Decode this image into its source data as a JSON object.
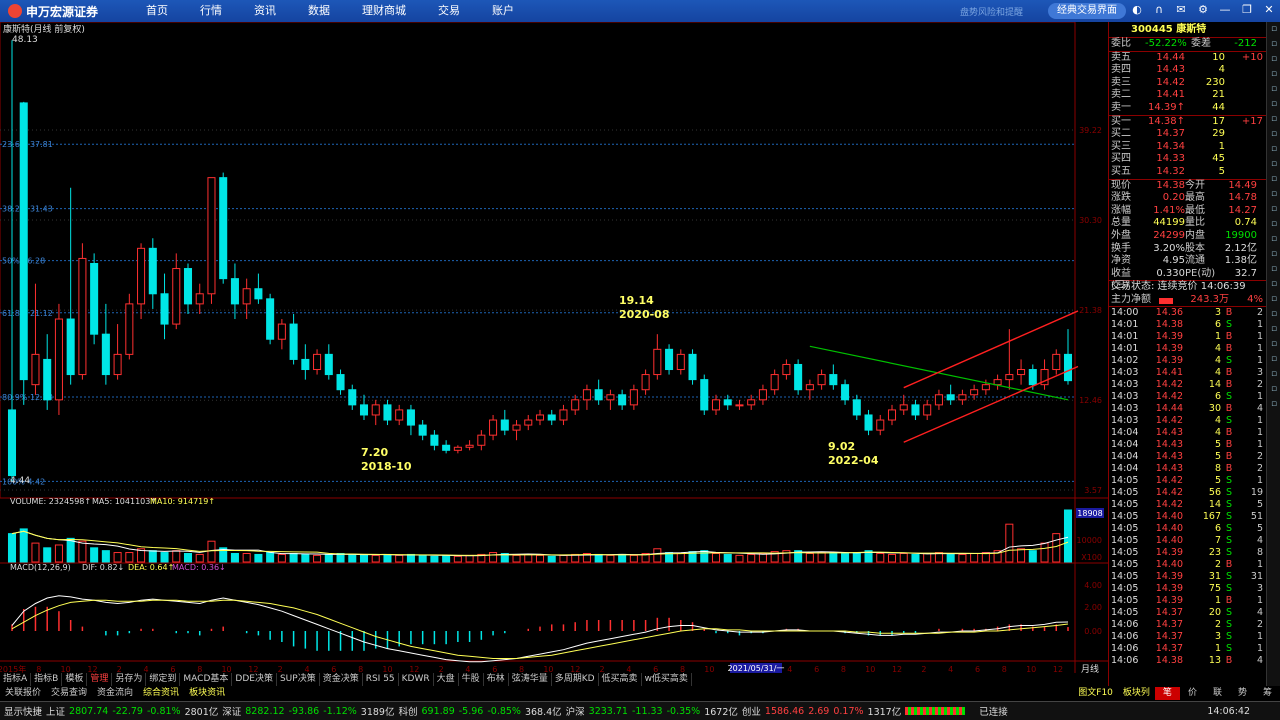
{
  "topbar": {
    "brand": "申万宏源证券",
    "nav": [
      "首页",
      "行情",
      "资讯",
      "数据",
      "理财商城",
      "交易",
      "账户"
    ],
    "hint": "盘势风险和提醒",
    "classic_button": "经典交易界面",
    "icons": [
      "theme-icon",
      "headset-icon",
      "mail-icon",
      "settings-icon",
      "minimize-icon",
      "restore-icon",
      "close-icon"
    ]
  },
  "chart": {
    "title": "康斯特(月线 前复权)",
    "price_max": "48.13",
    "price_min": "4.44",
    "fib_labels": [
      {
        "pct": "23.6%",
        "value": "37.81"
      },
      {
        "pct": "38.2%",
        "value": "31.43"
      },
      {
        "pct": "50%",
        "value": "26.28"
      },
      {
        "pct": "61.8%",
        "value": "21.12"
      },
      {
        "pct": "80.9%",
        "value": "12.78"
      },
      {
        "pct": "100%",
        "value": "4.42"
      }
    ],
    "right_axis": [
      "39.22",
      "30.30",
      "21.38",
      "12.46",
      "3.57"
    ],
    "annotations": [
      {
        "text": "19.14",
        "sub": "2020-08"
      },
      {
        "text": "7.20",
        "sub": "2018-10"
      },
      {
        "text": "9.02",
        "sub": "2022-04"
      }
    ],
    "volume_label": "VOLUME: 2324598↑",
    "ma5_label": "MA5: 1041103↑",
    "ma10_label": "MA10: 914719↑",
    "volume_axis": [
      "10000",
      "X100"
    ],
    "volume_tag": "18908",
    "macd_label": "MACD(12,26,9)",
    "dif_label": "DIF: 0.82↓",
    "dea_label": "DEA: 0.64↑",
    "macd_val": "MACD: 0.36↓",
    "macd_axis": [
      "4.00",
      "2.00",
      "0.00"
    ],
    "x_axis": [
      "2015年",
      "8",
      "10",
      "12",
      "2",
      "4",
      "6",
      "8",
      "10",
      "12",
      "2",
      "4",
      "6",
      "8",
      "10",
      "12",
      "2",
      "4",
      "6",
      "8",
      "10",
      "12",
      "2",
      "4",
      "6",
      "8",
      "10",
      "12",
      "2",
      "4",
      "6",
      "8",
      "10",
      "12",
      "2",
      "4",
      "6",
      "8",
      "10",
      "12"
    ],
    "cursor_date": "2021/05/31/一",
    "period": "月线",
    "colors": {
      "up": "#ff3030",
      "down": "#00e6e6",
      "ma5": "#ffffff",
      "ma10": "#ffff55",
      "trend": "#00c000",
      "channel": "#ff2020"
    }
  },
  "chart_data": {
    "type": "candlestick",
    "title": "康斯特(月线 前复权)",
    "ylim": [
      3.57,
      48.13
    ],
    "candles": [
      [
        11.5,
        48.1,
        4.4,
        5.0
      ],
      [
        41.9,
        42.0,
        12.0,
        14.5
      ],
      [
        14.0,
        24.0,
        13.0,
        17.0
      ],
      [
        16.5,
        19.0,
        11.5,
        12.5
      ],
      [
        12.5,
        22.0,
        11.0,
        20.5
      ],
      [
        20.5,
        33.5,
        14.0,
        15.0
      ],
      [
        15.0,
        28.0,
        14.5,
        26.5
      ],
      [
        26.0,
        27.0,
        18.0,
        19.0
      ],
      [
        19.0,
        22.0,
        14.0,
        15.0
      ],
      [
        15.0,
        20.0,
        14.5,
        17.0
      ],
      [
        17.0,
        23.0,
        16.5,
        22.0
      ],
      [
        22.0,
        28.0,
        20.5,
        27.5
      ],
      [
        27.5,
        28.5,
        21.5,
        23.0
      ],
      [
        23.0,
        25.0,
        18.5,
        20.0
      ],
      [
        20.0,
        27.0,
        19.5,
        25.5
      ],
      [
        25.5,
        26.0,
        21.0,
        22.0
      ],
      [
        22.0,
        24.0,
        21.0,
        23.0
      ],
      [
        23.0,
        34.5,
        22.0,
        34.5
      ],
      [
        34.5,
        35.0,
        24.0,
        24.5
      ],
      [
        24.5,
        26.0,
        20.5,
        22.0
      ],
      [
        22.0,
        24.5,
        20.5,
        23.5
      ],
      [
        23.5,
        25.0,
        22.0,
        22.5
      ],
      [
        22.5,
        23.0,
        18.0,
        18.5
      ],
      [
        18.5,
        20.5,
        17.5,
        20.0
      ],
      [
        20.0,
        21.0,
        16.0,
        16.5
      ],
      [
        16.5,
        18.0,
        14.5,
        15.5
      ],
      [
        15.5,
        17.5,
        15.0,
        17.0
      ],
      [
        17.0,
        18.0,
        14.5,
        15.0
      ],
      [
        15.0,
        15.5,
        13.0,
        13.5
      ],
      [
        13.5,
        14.0,
        11.5,
        12.0
      ],
      [
        12.0,
        13.0,
        10.5,
        11.0
      ],
      [
        11.0,
        12.5,
        10.0,
        12.0
      ],
      [
        12.0,
        12.5,
        10.0,
        10.5
      ],
      [
        10.5,
        12.0,
        10.0,
        11.5
      ],
      [
        11.5,
        12.0,
        9.0,
        10.0
      ],
      [
        10.0,
        10.5,
        8.5,
        9.0
      ],
      [
        9.0,
        9.5,
        7.5,
        8.0
      ],
      [
        8.0,
        8.5,
        7.2,
        7.5
      ],
      [
        7.5,
        8.0,
        7.2,
        7.8
      ],
      [
        7.8,
        8.5,
        7.5,
        8.0
      ],
      [
        8.0,
        9.5,
        7.5,
        9.0
      ],
      [
        9.0,
        11.0,
        8.5,
        10.5
      ],
      [
        10.5,
        11.5,
        9.0,
        9.5
      ],
      [
        9.5,
        10.5,
        8.5,
        10.0
      ],
      [
        10.0,
        11.0,
        9.5,
        10.5
      ],
      [
        10.5,
        11.5,
        10.0,
        11.0
      ],
      [
        11.0,
        11.5,
        10.0,
        10.5
      ],
      [
        10.5,
        12.0,
        10.0,
        11.5
      ],
      [
        11.5,
        13.0,
        11.0,
        12.5
      ],
      [
        12.5,
        14.0,
        11.5,
        13.5
      ],
      [
        13.5,
        14.5,
        12.0,
        12.5
      ],
      [
        12.5,
        13.5,
        11.5,
        13.0
      ],
      [
        13.0,
        13.5,
        11.5,
        12.0
      ],
      [
        12.0,
        14.0,
        11.5,
        13.5
      ],
      [
        13.5,
        15.5,
        13.0,
        15.0
      ],
      [
        15.0,
        19.0,
        14.5,
        17.5
      ],
      [
        17.5,
        18.0,
        15.0,
        15.5
      ],
      [
        15.5,
        17.5,
        15.0,
        17.0
      ],
      [
        17.0,
        17.5,
        14.0,
        14.5
      ],
      [
        14.5,
        15.0,
        11.0,
        11.5
      ],
      [
        11.5,
        13.0,
        11.0,
        12.5
      ],
      [
        12.5,
        13.0,
        11.5,
        12.0
      ],
      [
        12.0,
        12.5,
        11.5,
        12.0
      ],
      [
        12.0,
        13.0,
        11.5,
        12.5
      ],
      [
        12.5,
        14.0,
        12.0,
        13.5
      ],
      [
        13.5,
        15.5,
        13.0,
        15.0
      ],
      [
        15.0,
        16.5,
        14.5,
        16.0
      ],
      [
        16.0,
        16.5,
        13.0,
        13.5
      ],
      [
        13.5,
        14.5,
        12.5,
        14.0
      ],
      [
        14.0,
        15.5,
        13.5,
        15.0
      ],
      [
        15.0,
        16.0,
        13.5,
        14.0
      ],
      [
        14.0,
        14.5,
        12.0,
        12.5
      ],
      [
        12.5,
        13.0,
        10.5,
        11.0
      ],
      [
        11.0,
        11.5,
        9.0,
        9.5
      ],
      [
        9.5,
        11.0,
        9.0,
        10.5
      ],
      [
        10.5,
        12.0,
        10.0,
        11.5
      ],
      [
        11.5,
        13.0,
        11.0,
        12.0
      ],
      [
        12.0,
        12.5,
        10.5,
        11.0
      ],
      [
        11.0,
        12.5,
        10.5,
        12.0
      ],
      [
        12.0,
        13.5,
        11.5,
        13.0
      ],
      [
        13.0,
        14.0,
        12.0,
        12.5
      ],
      [
        12.5,
        13.5,
        12.0,
        13.0
      ],
      [
        13.0,
        14.0,
        12.5,
        13.5
      ],
      [
        13.5,
        14.5,
        13.0,
        14.0
      ],
      [
        14.0,
        15.0,
        13.5,
        14.5
      ],
      [
        14.5,
        19.5,
        13.5,
        15.0
      ],
      [
        15.0,
        16.5,
        14.0,
        15.5
      ],
      [
        15.5,
        16.0,
        13.5,
        14.0
      ],
      [
        14.0,
        16.5,
        13.5,
        15.5
      ],
      [
        15.5,
        17.5,
        15.0,
        17.0
      ],
      [
        17.0,
        19.5,
        14.0,
        14.4
      ]
    ],
    "volume": [
      30,
      35,
      20,
      15,
      18,
      25,
      22,
      15,
      12,
      10,
      10,
      14,
      12,
      10,
      12,
      9,
      8,
      22,
      15,
      9,
      9,
      8,
      10,
      8,
      9,
      8,
      7,
      8,
      9,
      8,
      7,
      7,
      8,
      7,
      8,
      7,
      6,
      7,
      6,
      7,
      8,
      10,
      9,
      7,
      8,
      7,
      6,
      7,
      8,
      9,
      8,
      7,
      8,
      7,
      9,
      14,
      10,
      9,
      11,
      12,
      9,
      8,
      7,
      8,
      9,
      11,
      12,
      12,
      9,
      10,
      10,
      9,
      10,
      12,
      9,
      8,
      9,
      8,
      9,
      10,
      9,
      8,
      9,
      10,
      12,
      40,
      14,
      12,
      20,
      30,
      55
    ],
    "dif": [
      0.5,
      1.8,
      2.5,
      3.0,
      3.2,
      3.1,
      2.9,
      2.8,
      2.6,
      2.5,
      2.6,
      2.8,
      2.9,
      2.8,
      2.7,
      2.6,
      2.5,
      2.8,
      3.0,
      2.8,
      2.6,
      2.4,
      2.1,
      1.8,
      1.4,
      1.0,
      0.6,
      0.2,
      -0.2,
      -0.6,
      -1.0,
      -1.3,
      -1.6,
      -1.8,
      -2.0,
      -2.2,
      -2.4,
      -2.6,
      -2.7,
      -2.8,
      -2.8,
      -2.7,
      -2.6,
      -2.5,
      -2.3,
      -2.1,
      -1.9,
      -1.7,
      -1.4,
      -1.1,
      -0.9,
      -0.7,
      -0.5,
      -0.3,
      -0.1,
      0.2,
      0.4,
      0.5,
      0.5,
      0.3,
      0.1,
      0.0,
      -0.1,
      -0.1,
      -0.1,
      0.0,
      0.1,
      0.1,
      0.0,
      0.0,
      0.0,
      -0.1,
      -0.2,
      -0.3,
      -0.4,
      -0.4,
      -0.3,
      -0.3,
      -0.2,
      -0.1,
      -0.1,
      0.0,
      0.0,
      0.1,
      0.2,
      0.4,
      0.5,
      0.5,
      0.6,
      0.8,
      0.82
    ],
    "dea": [
      0.2,
      0.8,
      1.4,
      1.9,
      2.3,
      2.6,
      2.7,
      2.8,
      2.8,
      2.7,
      2.7,
      2.7,
      2.8,
      2.8,
      2.8,
      2.7,
      2.7,
      2.7,
      2.8,
      2.8,
      2.7,
      2.6,
      2.5,
      2.3,
      2.1,
      1.8,
      1.5,
      1.1,
      0.7,
      0.3,
      -0.1,
      -0.5,
      -0.8,
      -1.1,
      -1.4,
      -1.6,
      -1.8,
      -2.0,
      -2.2,
      -2.3,
      -2.4,
      -2.5,
      -2.5,
      -2.5,
      -2.4,
      -2.3,
      -2.2,
      -2.0,
      -1.8,
      -1.6,
      -1.4,
      -1.2,
      -1.0,
      -0.8,
      -0.6,
      -0.4,
      -0.2,
      0.0,
      0.1,
      0.2,
      0.2,
      0.1,
      0.1,
      0.0,
      0.0,
      0.0,
      0.0,
      0.0,
      0.0,
      0.0,
      0.0,
      0.0,
      -0.1,
      -0.1,
      -0.2,
      -0.2,
      -0.2,
      -0.2,
      -0.2,
      -0.2,
      -0.1,
      -0.1,
      -0.1,
      0.0,
      0.0,
      0.1,
      0.2,
      0.3,
      0.4,
      0.5,
      0.64
    ]
  },
  "panel": {
    "code": "300445 康斯特",
    "weibi": {
      "label": "委比",
      "value": "-52.22%",
      "label2": "委差",
      "value2": "-212"
    },
    "asks": [
      {
        "label": "卖五",
        "price": "14.44",
        "vol": "10",
        "chg": "+10"
      },
      {
        "label": "卖四",
        "price": "14.43",
        "vol": "4",
        "chg": ""
      },
      {
        "label": "卖三",
        "price": "14.42",
        "vol": "230",
        "chg": ""
      },
      {
        "label": "卖二",
        "price": "14.41",
        "vol": "21",
        "chg": ""
      },
      {
        "label": "卖一",
        "price": "14.39↑",
        "vol": "44",
        "chg": ""
      }
    ],
    "bids": [
      {
        "label": "买一",
        "price": "14.38↑",
        "vol": "17",
        "chg": "+17"
      },
      {
        "label": "买二",
        "price": "14.37",
        "vol": "29",
        "chg": ""
      },
      {
        "label": "买三",
        "price": "14.34",
        "vol": "1",
        "chg": ""
      },
      {
        "label": "买四",
        "price": "14.33",
        "vol": "45",
        "chg": ""
      },
      {
        "label": "买五",
        "price": "14.32",
        "vol": "5",
        "chg": ""
      }
    ],
    "stats": [
      {
        "l1": "现价",
        "v1": "14.38",
        "l2": "今开",
        "v2": "14.49",
        "c1": "red",
        "c2": "red"
      },
      {
        "l1": "涨跌",
        "v1": "0.20",
        "l2": "最高",
        "v2": "14.78",
        "c1": "red",
        "c2": "red"
      },
      {
        "l1": "涨幅",
        "v1": "1.41%",
        "l2": "最低",
        "v2": "14.27",
        "c1": "red",
        "c2": "red"
      },
      {
        "l1": "总量",
        "v1": "44199",
        "l2": "量比",
        "v2": "0.74",
        "c1": "yellow",
        "c2": "yellow"
      },
      {
        "l1": "外盘",
        "v1": "24299",
        "l2": "内盘",
        "v2": "19900",
        "c1": "red",
        "c2": "green"
      },
      {
        "l1": "换手",
        "v1": "3.20%",
        "l2": "股本",
        "v2": "2.12亿",
        "c1": "white",
        "c2": "white"
      },
      {
        "l1": "净资",
        "v1": "4.95",
        "l2": "流通",
        "v2": "1.38亿",
        "c1": "white",
        "c2": "white"
      },
      {
        "l1": "收益(三)",
        "v1": "0.330",
        "l2": "PE(动)",
        "v2": "32.7",
        "c1": "white",
        "c2": "white"
      }
    ],
    "status_line": "交易状态: 连续竞价 14:06:39",
    "main_net": {
      "label": "主力净额",
      "value": "243.3万",
      "pct": "4%"
    },
    "ticks": [
      [
        "14:00",
        "14.36",
        "3",
        "B",
        "2"
      ],
      [
        "14:01",
        "14.38",
        "6",
        "S",
        "1"
      ],
      [
        "14:01",
        "14.39",
        "1",
        "B",
        "1"
      ],
      [
        "14:01",
        "14.39",
        "4",
        "B",
        "1"
      ],
      [
        "14:02",
        "14.39",
        "4",
        "S",
        "1"
      ],
      [
        "14:03",
        "14.41",
        "4",
        "B",
        "3"
      ],
      [
        "14:03",
        "14.42",
        "14",
        "B",
        "2"
      ],
      [
        "14:03",
        "14.42",
        "6",
        "S",
        "1"
      ],
      [
        "14:03",
        "14.44",
        "30",
        "B",
        "4"
      ],
      [
        "14:03",
        "14.42",
        "4",
        "S",
        "1"
      ],
      [
        "14:04",
        "14.43",
        "4",
        "B",
        "1"
      ],
      [
        "14:04",
        "14.43",
        "5",
        "B",
        "1"
      ],
      [
        "14:04",
        "14.43",
        "5",
        "B",
        "2"
      ],
      [
        "14:04",
        "14.43",
        "8",
        "B",
        "2"
      ],
      [
        "14:05",
        "14.42",
        "5",
        "S",
        "1"
      ],
      [
        "14:05",
        "14.42",
        "56",
        "S",
        "19"
      ],
      [
        "14:05",
        "14.42",
        "14",
        "S",
        "5"
      ],
      [
        "14:05",
        "14.40",
        "167",
        "S",
        "51"
      ],
      [
        "14:05",
        "14.40",
        "6",
        "S",
        "5"
      ],
      [
        "14:05",
        "14.40",
        "7",
        "S",
        "4"
      ],
      [
        "14:05",
        "14.39",
        "23",
        "S",
        "8"
      ],
      [
        "14:05",
        "14.40",
        "2",
        "B",
        "1"
      ],
      [
        "14:05",
        "14.39",
        "31",
        "S",
        "31"
      ],
      [
        "14:05",
        "14.39",
        "75",
        "S",
        "3"
      ],
      [
        "14:05",
        "14.39",
        "1",
        "B",
        "1"
      ],
      [
        "14:05",
        "14.37",
        "20",
        "S",
        "4"
      ],
      [
        "14:06",
        "14.37",
        "2",
        "S",
        "2"
      ],
      [
        "14:06",
        "14.37",
        "3",
        "S",
        "1"
      ],
      [
        "14:06",
        "14.37",
        "1",
        "S",
        "1"
      ],
      [
        "14:06",
        "14.38",
        "13",
        "B",
        "4"
      ]
    ]
  },
  "tabs_row1": [
    "指标A",
    "指标B",
    "模板",
    "管理",
    "另存为",
    "绑定到",
    "MACD基本",
    "DDE决策",
    "SUP决策",
    "资金决策",
    "RSI 55",
    "KDWR",
    "大盘",
    "牛股",
    "布林",
    "弦涛华量",
    "多周期KD",
    "低买高卖",
    "w低买高卖"
  ],
  "tabs_row2": [
    "关联报价",
    "交易查询",
    "资金流向",
    "综合资讯",
    "板块资讯"
  ],
  "tabs_row2_right": [
    "图文F10",
    "板块列"
  ],
  "panel_tabs": [
    "笔",
    "价",
    "联",
    "势",
    "筹"
  ],
  "status": {
    "app": "显示快捷",
    "sh_label": "上证",
    "sh": "2807.74",
    "sh_chg": "-22.79",
    "sh_pct": "-0.81%",
    "sh_amt": "2801亿",
    "sz_label": "深证",
    "sz": "8282.12",
    "sz_chg": "-93.86",
    "sz_pct": "-1.12%",
    "sz_amt": "3189亿",
    "kc_label": "科创",
    "kc": "691.89",
    "kc_chg": "-5.96",
    "kc_pct": "-0.85%",
    "kc_amt": "368.4亿",
    "hs_label": "沪深",
    "hs": "3233.71",
    "hs_chg": "-11.33",
    "hs_pct": "-0.35%",
    "hs_amt": "1672亿",
    "cy_label": "创业",
    "cy": "1586.46",
    "cy_chg": "2.69",
    "cy_pct": "0.17%",
    "cy_amt": "1317亿",
    "conn": "已连接",
    "time": "14:06:42"
  }
}
